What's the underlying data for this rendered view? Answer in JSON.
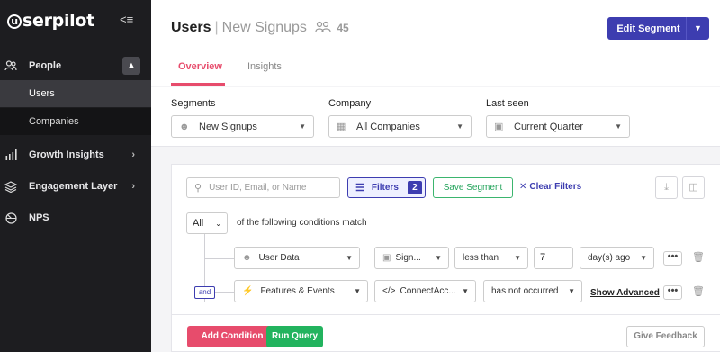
{
  "app": {
    "logo": "serpilot"
  },
  "sidebar": {
    "items": [
      {
        "label": "People"
      },
      {
        "label": "Users"
      },
      {
        "label": "Companies"
      },
      {
        "label": "Growth Insights"
      },
      {
        "label": "Engagement Layer"
      },
      {
        "label": "NPS"
      }
    ]
  },
  "header": {
    "title": "Users",
    "separator": "|",
    "segment": "New Signups",
    "count": "45",
    "edit_button": "Edit Segment",
    "tabs": [
      {
        "label": "Overview",
        "active": true
      },
      {
        "label": "Insights"
      }
    ]
  },
  "filters": {
    "segments_label": "Segments",
    "segments_value": "New Signups",
    "company_label": "Company",
    "company_value": "All Companies",
    "last_seen_label": "Last seen",
    "last_seen_value": "Current Quarter"
  },
  "query": {
    "search_placeholder": "User ID, Email, or Name",
    "filters_label": "Filters",
    "filters_count": "2",
    "save_segment": "Save Segment",
    "clear_filters": "Clear Filters",
    "match_value": "All",
    "match_text": "of the following conditions match",
    "and_label": "and",
    "conditions": [
      {
        "type": "User Data",
        "field": "Sign...",
        "operator": "less than",
        "value": "7",
        "unit": "day(s) ago"
      },
      {
        "type": "Features & Events",
        "field": "ConnectAcc...",
        "operator": "has not occurred",
        "extra": "Show Advanced"
      }
    ],
    "more": "•••",
    "add_condition": "Add Condition",
    "run_query": "Run Query",
    "give_feedback": "Give Feedback"
  },
  "colors": {
    "accent": "#3d3db0",
    "pink": "#e74c6c",
    "green": "#22b35e",
    "sidebar": "#1d1d20"
  }
}
